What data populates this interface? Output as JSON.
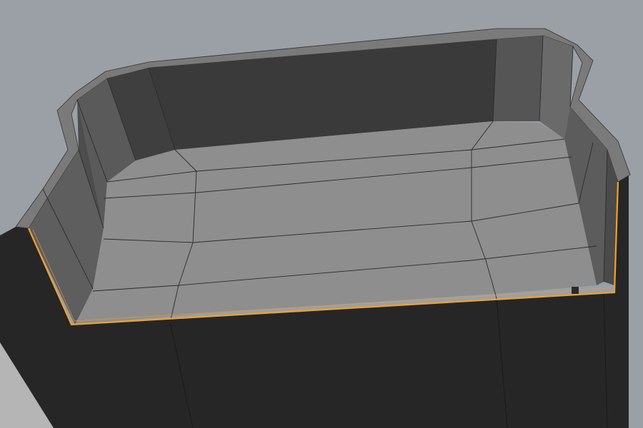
{
  "viewport": {
    "background_color": "#9aa0a6",
    "selection_color": "#f0a030",
    "wire_color": "#1e1e1e"
  },
  "scene": {
    "object": {
      "type": "mesh",
      "selected_mode": "edge-loop",
      "colors": {
        "outer_dark": "#262626",
        "rim_top": "#6e6e6e",
        "inner_wall_light": "#5a5a5a",
        "inner_wall_mid": "#444444",
        "floor": "#8e8e8e"
      }
    }
  }
}
